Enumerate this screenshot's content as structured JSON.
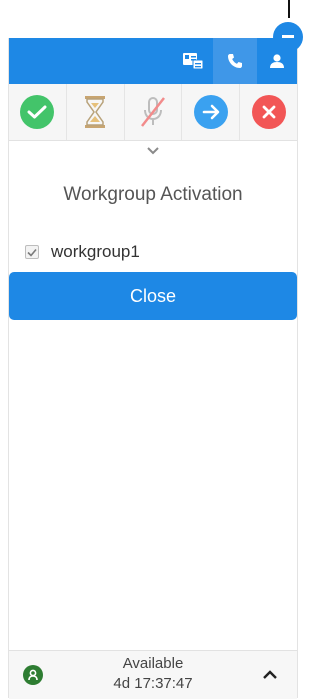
{
  "colors": {
    "primary": "#1e88e5",
    "accept": "#43c46a",
    "reject": "#f25656",
    "transfer": "#3aa1f0",
    "status_ok": "#2e7d32"
  },
  "topbar": {
    "icons": [
      "menu-icon",
      "contact-card-icon",
      "phone-icon",
      "user-icon"
    ]
  },
  "actions": {
    "icons": [
      "check-icon",
      "hourglass-icon",
      "microphone-mute-icon",
      "arrow-right-icon",
      "close-icon"
    ]
  },
  "dialog": {
    "title": "Workgroup Activation",
    "workgroup_label": "workgroup1",
    "workgroup_checked": true,
    "close_label": "Close"
  },
  "status": {
    "state": "Available",
    "duration": "4d 17:37:47"
  }
}
